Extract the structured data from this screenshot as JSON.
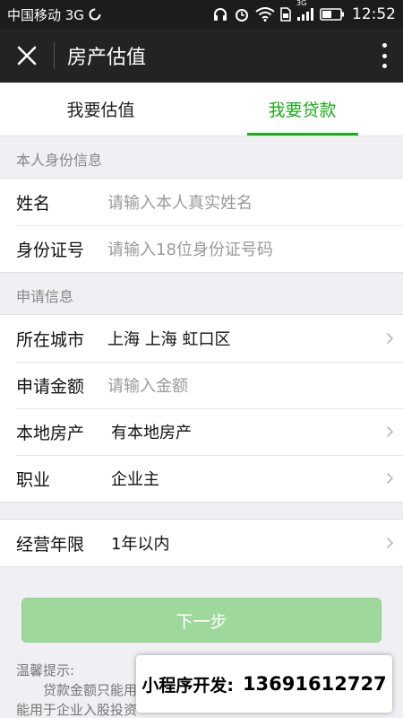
{
  "status": {
    "carrier": "中国移动 3G",
    "net_small": "3G",
    "time": "12:52"
  },
  "nav": {
    "title": "房产估值"
  },
  "tabs": [
    {
      "label": "我要估值",
      "active": false
    },
    {
      "label": "我要贷款",
      "active": true
    }
  ],
  "identity": {
    "section_title": "本人身份信息",
    "name_label": "姓名",
    "name_placeholder": "请输入本人真实姓名",
    "id_label": "身份证号",
    "id_placeholder": "请输入18位身份证号码"
  },
  "application": {
    "section_title": "申请信息",
    "city_label": "所在城市",
    "city_value": "上海 上海 虹口区",
    "amount_label": "申请金额",
    "amount_placeholder": "请输入金额",
    "property_label": "本地房产",
    "property_value": "有本地房产",
    "job_label": "职业",
    "job_value": "企业主"
  },
  "business": {
    "years_label": "经营年限",
    "years_value": "1年以内"
  },
  "next_button": "下一步",
  "tips": {
    "title": "温馨提示:",
    "line1": "贷款金额只能用",
    "line2": "能用于企业入股投资"
  },
  "promo": {
    "label": "小程序开发:",
    "phone": "13691612727"
  },
  "colors": {
    "accent": "#1aad19",
    "button_disabled": "#9ed99b",
    "navbar": "#232323"
  },
  "icons": [
    "close-icon",
    "more-icon",
    "chevron-right-icon",
    "headphones-icon",
    "alarm-icon",
    "wifi-icon",
    "signal-icon",
    "battery-icon",
    "loading-icon",
    "sim-icon"
  ]
}
